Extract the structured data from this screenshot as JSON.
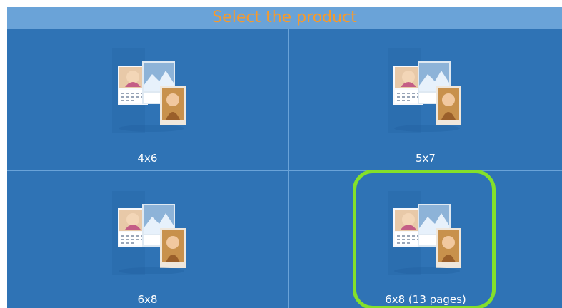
{
  "header": {
    "title": "Select the product"
  },
  "products": [
    {
      "label": "4x6"
    },
    {
      "label": "5x7"
    },
    {
      "label": "6x8"
    },
    {
      "label": "6x8 (13 pages)"
    }
  ],
  "colors": {
    "background": "#2f73b5",
    "header_background": "#6aa3d8",
    "title_text": "#f59a2e",
    "label_text": "#ffffff",
    "highlight": "#84e02a"
  },
  "icons": {
    "product_thumbnail": "calendar-photo-product-icon"
  }
}
